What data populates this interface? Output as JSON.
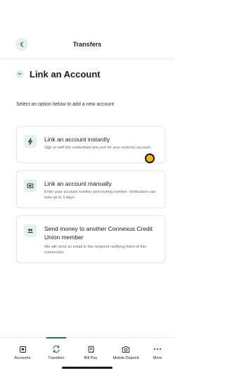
{
  "header": {
    "title": "Transfers"
  },
  "section": {
    "title": "Link an Account",
    "intro": "Select an option below to add a new account"
  },
  "options": [
    {
      "title": "Link an account instantly",
      "description": "Sign in with the credentials you use for your external account.",
      "icon": "lightning-icon"
    },
    {
      "title": "Link an account manually",
      "description": "Enter your account number and routing number. Verification can take up to 3 days.",
      "icon": "bank-card-icon"
    },
    {
      "title": "Send money to another Connexus Credit Union member",
      "description": "We will send an email to the recipient notifying them of this connection.",
      "icon": "people-icon"
    }
  ],
  "tabs": [
    {
      "label": "Accounts",
      "icon": "accounts-icon",
      "active": false
    },
    {
      "label": "Transfers",
      "icon": "transfers-icon",
      "active": true
    },
    {
      "label": "Bill Pay",
      "icon": "bill-pay-icon",
      "active": false
    },
    {
      "label": "Mobile Deposit",
      "icon": "camera-icon",
      "active": false
    },
    {
      "label": "More",
      "icon": "more-dots-icon",
      "active": false
    }
  ],
  "colors": {
    "accent": "#1d7b4b",
    "accent_light": "#e3f1e8",
    "cursor": "#f2b519"
  }
}
